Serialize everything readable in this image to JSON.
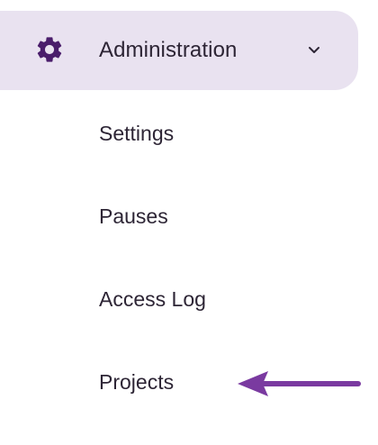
{
  "admin_section": {
    "label": "Administration",
    "icon": "gear-icon",
    "expanded": true,
    "toggle_icon": "chevron-down-icon"
  },
  "sub_items": [
    {
      "label": "Settings"
    },
    {
      "label": "Pauses"
    },
    {
      "label": "Access Log"
    },
    {
      "label": "Projects"
    }
  ],
  "colors": {
    "accent": "#4a1d6b",
    "header_bg": "#e9e2f0",
    "text": "#2d2535",
    "annotation_arrow": "#7a3aa0"
  },
  "annotation": {
    "icon": "arrow-left-icon",
    "points_to": "Projects"
  }
}
